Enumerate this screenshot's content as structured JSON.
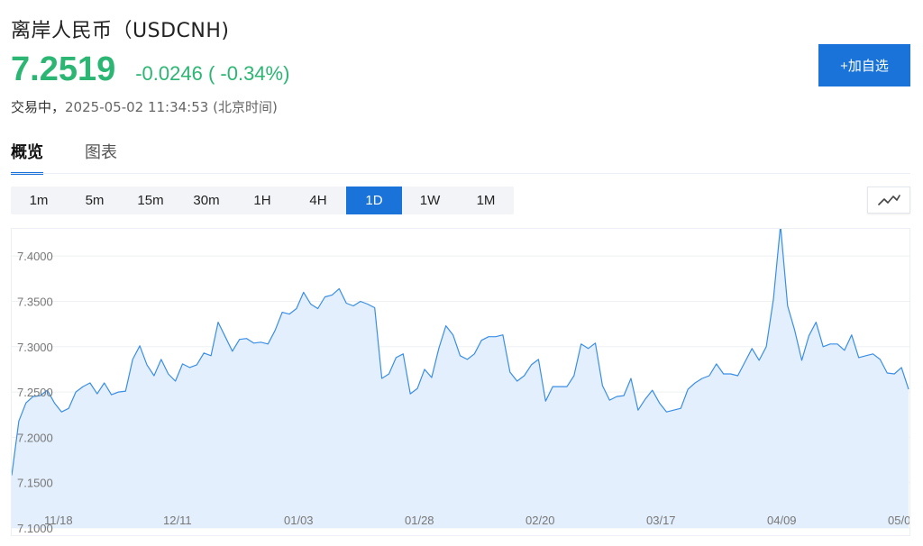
{
  "header": {
    "title": "离岸人民币（USDCNH)",
    "price": "7.2519",
    "change": "-0.0246 ( -0.34%)",
    "status": "交易中，",
    "timestamp": "2025-05-02 11:34:53",
    "timezone": "(北京时间)",
    "add_watchlist": "+加自选",
    "accent_color": "#2bb673",
    "brand_color": "#1a73d9"
  },
  "tabs": [
    {
      "label": "概览",
      "active": true
    },
    {
      "label": "图表",
      "active": false
    }
  ],
  "periods": [
    {
      "label": "1m",
      "active": false
    },
    {
      "label": "5m",
      "active": false
    },
    {
      "label": "15m",
      "active": false
    },
    {
      "label": "30m",
      "active": false
    },
    {
      "label": "1H",
      "active": false
    },
    {
      "label": "4H",
      "active": false
    },
    {
      "label": "1D",
      "active": true
    },
    {
      "label": "1W",
      "active": false
    },
    {
      "label": "1M",
      "active": false
    }
  ],
  "chart_type_icon": "line-chart-icon",
  "chart_data": {
    "type": "area",
    "title": "",
    "xlabel": "",
    "ylabel": "",
    "ylim": [
      7.1,
      7.43
    ],
    "yticks": [
      "7.1000",
      "7.1500",
      "7.2000",
      "7.2500",
      "7.3000",
      "7.3500",
      "7.4000"
    ],
    "xticks": [
      "11/18",
      "12/11",
      "01/03",
      "01/28",
      "02/20",
      "03/17",
      "04/09",
      "05/0"
    ],
    "grid": true,
    "line_color": "#3a8ee6",
    "fill_color": "#e3effc",
    "series": [
      {
        "values": [
          7.158,
          7.218,
          7.238,
          7.245,
          7.246,
          7.252,
          7.238,
          7.228,
          7.232,
          7.25,
          7.256,
          7.26,
          7.248,
          7.26,
          7.247,
          7.25,
          7.251,
          7.286,
          7.301,
          7.28,
          7.268,
          7.286,
          7.27,
          7.262,
          7.281,
          7.277,
          7.28,
          7.293,
          7.29,
          7.327,
          7.311,
          7.295,
          7.308,
          7.309,
          7.304,
          7.305,
          7.303,
          7.318,
          7.338,
          7.336,
          7.342,
          7.36,
          7.347,
          7.342,
          7.355,
          7.357,
          7.364,
          7.348,
          7.345,
          7.35,
          7.347,
          7.343,
          7.265,
          7.27,
          7.288,
          7.292,
          7.248,
          7.254,
          7.275,
          7.266,
          7.298,
          7.323,
          7.313,
          7.29,
          7.286,
          7.292,
          7.307,
          7.311,
          7.311,
          7.313,
          7.272,
          7.262,
          7.268,
          7.28,
          7.286,
          7.24,
          7.256,
          7.256,
          7.256,
          7.268,
          7.303,
          7.298,
          7.304,
          7.257,
          7.241,
          7.245,
          7.246,
          7.265,
          7.23,
          7.242,
          7.252,
          7.238,
          7.228,
          7.23,
          7.232,
          7.253,
          7.26,
          7.265,
          7.268,
          7.281,
          7.27,
          7.27,
          7.268,
          7.283,
          7.298,
          7.285,
          7.3,
          7.352,
          7.434,
          7.345,
          7.318,
          7.285,
          7.312,
          7.327,
          7.3,
          7.303,
          7.303,
          7.296,
          7.313,
          7.288,
          7.29,
          7.292,
          7.286,
          7.271,
          7.27,
          7.277,
          7.253
        ]
      }
    ]
  }
}
